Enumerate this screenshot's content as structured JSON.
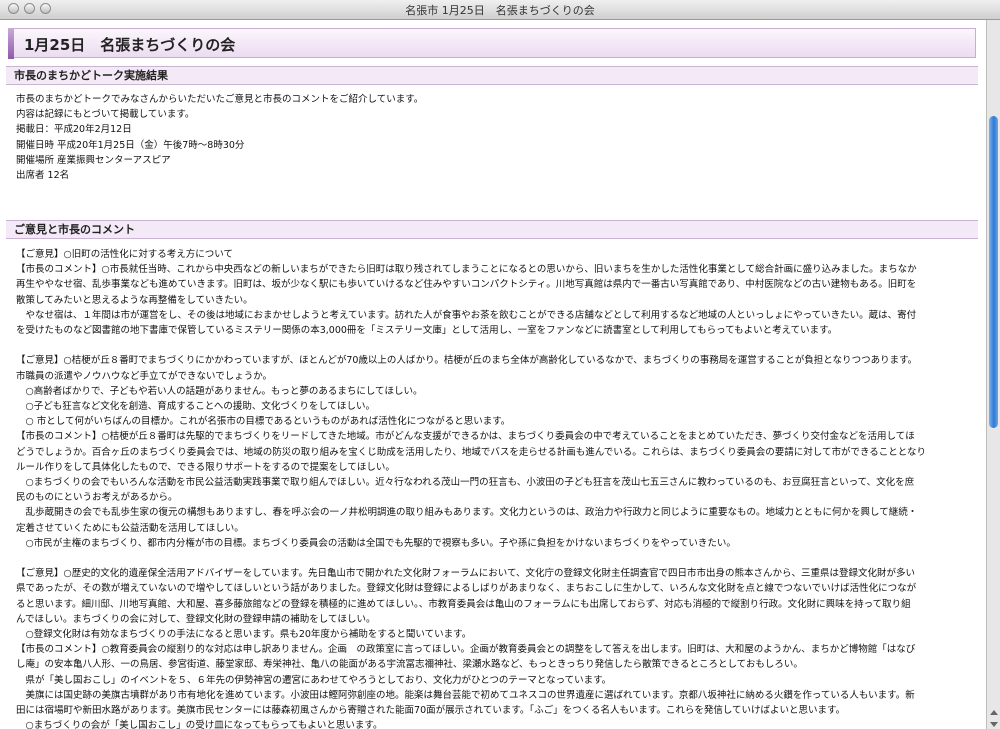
{
  "window": {
    "title": "名張市 1月25日　名張まちづくりの会"
  },
  "page": {
    "heading": "1月25日　名張まちづくりの会"
  },
  "section1": {
    "heading": "市長のまちかどトーク実施結果",
    "lines": [
      "市長のまちかどトークでみなさんからいただいたご意見と市長のコメントをご紹介しています。",
      "内容は記録にもとづいて掲載しています。",
      "掲載日：平成20年2月12日",
      "開催日時 平成20年1月25日（金）午後7時～8時30分",
      "開催場所 産業振興センターアスピア",
      "出席者 12名"
    ]
  },
  "section2": {
    "heading": "ご意見と市長のコメント",
    "lines": [
      "【ご意見】○旧町の活性化に対する考え方について",
      "【市長のコメント】○市長就任当時、これから中央西などの新しいまちができたら旧町は取り残されてしまうことになるとの思いから、旧いまちを生かした活性化事業として総合計画に盛り込みました。まちなか",
      "再生ややなせ宿、乱歩事業なども進めていきます。旧町は、坂が少なく駅にも歩いていけるなど住みやすいコンパクトシティ。川地写真館は県内で一番古い写真館であり、中村医院などの古い建物もある。旧町を",
      "散策してみたいと思えるような再整備をしていきたい。",
      "　やなせ宿は、１年間は市が運営をし、その後は地域におまかせしようと考えています。訪れた人が食事やお茶を飲むことができる店舗などとして利用するなど地域の人といっしょにやっていきたい。蔵は、寄付",
      "を受けたものなど図書館の地下書庫で保管しているミステリー関係の本3,000冊を「ミステリー文庫」として活用し、一室をファンなどに読書室として利用してもらってもよいと考えています。",
      "",
      "【ご意見】○桔梗が丘８番町でまちづくりにかかわっていますが、ほとんどが70歳以上の人ばかり。桔梗が丘のまち全体が高齢化しているなかで、まちづくりの事務局を運営することが負担となりつつあります。",
      "市職員の派遣やノウハウなど手立てができないでしょうか。",
      "　○高齢者ばかりで、子どもや若い人の話題がありません。もっと夢のあるまちにしてほしい。",
      "　○子ども狂言など文化を創造、育成することへの援助、文化づくりをしてほしい。",
      "　○ 市として何がいちばんの目標か。これが名張市の目標であるというものがあれば活性化につながると思います。",
      "【市長のコメント】○桔梗が丘８番町は先駆的でまちづくりをリードしてきた地域。市がどんな支援ができるかは、まちづくり委員会の中で考えていることをまとめていただき、夢づくり交付金などを活用してほ",
      "どうでしょうか。百合ヶ丘のまちづくり委員会では、地域の防災の取り組みを宝くじ助成を活用したり、地域でバスを走らせる計画も進んでいる。これらは、まちづくり委員会の要請に対して市ができることとなり",
      "ルール作りをして具体化したもので、できる限りサポートをするので提案をしてほしい。",
      "　○まちづくりの会でもいろんな活動を市民公益活動実践事業で取り組んでほしい。近々行なわれる茂山一門の狂言も、小波田の子ども狂言を茂山七五三さんに教わっているのも、お豆腐狂言といって、文化を庶",
      "民のものにというお考えがあるから。",
      "　乱歩蔵開きの会でも乱歩生家の復元の構想もありますし、春を呼ぶ会の一ノ井松明調進の取り組みもあります。文化力というのは、政治力や行政力と同じように重要なもの。地域力とともに何かを興して継続・",
      "定着させていくためにも公益活動を活用してほしい。",
      "　○市民が主権のまちづくり、都市内分権が市の目標。まちづくり委員会の活動は全国でも先駆的で視察も多い。子や孫に負担をかけないまちづくりをやっていきたい。",
      "",
      "【ご意見】○歴史的文化的遺産保全活用アドバイザーをしています。先日亀山市で開かれた文化財フォーラムにおいて、文化庁の登録文化財主任調査官で四日市市出身の熊本さんから、三重県は登録文化財が多い",
      "県であったが、その数が増えていないので増やしてほしいという話がありました。登録文化財は登録によるしばりがあまりなく、まちおこしに生かして、いろんな文化財を点と線でつないでいけば活性化につなが",
      "ると思います。細川邸、川地写真館、大和屋、喜多藤旅館などの登録を積極的に進めてほしい。、市教育委員会は亀山のフォーラムにも出席しておらず、対応も消極的で縦割り行政。文化財に興味を持って取り組",
      "んでほしい。まちづくりの会に対して、登録文化財の登録申請の補助をしてほしい。",
      "　○登録文化財は有効なまちづくりの手法になると思います。県も20年度から補助をすると聞いています。",
      "【市長のコメント】○教育委員会の縦割り的な対応は申し訳ありません。企画　の政策室に言ってほしい。企画が教育委員会との調整をして答えを出します。旧町は、大和屋のようかん、まちかど博物館「はなび",
      "し庵」の安本亀八人形、一の鳥居、参宮街道、藤堂家邸、寿栄神社、亀八の能面がある宇流冨志禰神社、梁瀬水路など、もっときっちり発信したら散策できるところとしておもしろい。",
      "　県が「美し国おこし」のイベントを５、６年先の伊勢神宮の遷宮にあわせてやろうとしており、文化力がひとつのテーマとなっています。",
      "　美旗には国史跡の美旗古墳群があり市有地化を進めています。小波田は鰹阿弥創座の地。能楽は舞台芸能で初めてユネスコの世界遺産に選ばれています。京都八坂神社に納める火鑚を作っている人もいます。新",
      "田には宿場町や新田水路があります。美旗市民センターには藤森初風さんから寄贈された能面70面が展示されています。「ふご」をつくる名人もいます。これらを発信していけばよいと思います。",
      "　○まちづくりの会が「美し国おこし」の受け皿になってもらってもよいと思います。"
    ]
  }
}
